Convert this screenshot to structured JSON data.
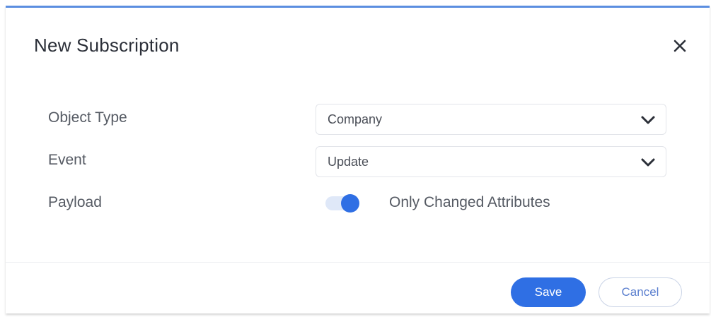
{
  "dialog": {
    "title": "New Subscription",
    "close_icon": "close-icon"
  },
  "form": {
    "object_type": {
      "label": "Object Type",
      "value": "Company",
      "icon": "chevron-down-icon"
    },
    "event": {
      "label": "Event",
      "value": "Update",
      "icon": "chevron-down-icon"
    },
    "payload": {
      "label": "Payload",
      "toggle_on": true,
      "toggle_label": "Only Changed Attributes"
    }
  },
  "footer": {
    "save_label": "Save",
    "cancel_label": "Cancel"
  },
  "colors": {
    "accent": "#2f6fe4",
    "top_border": "#5b8ee0",
    "toggle_track": "#dfe8f8",
    "cancel_text": "#5b7fcf"
  }
}
